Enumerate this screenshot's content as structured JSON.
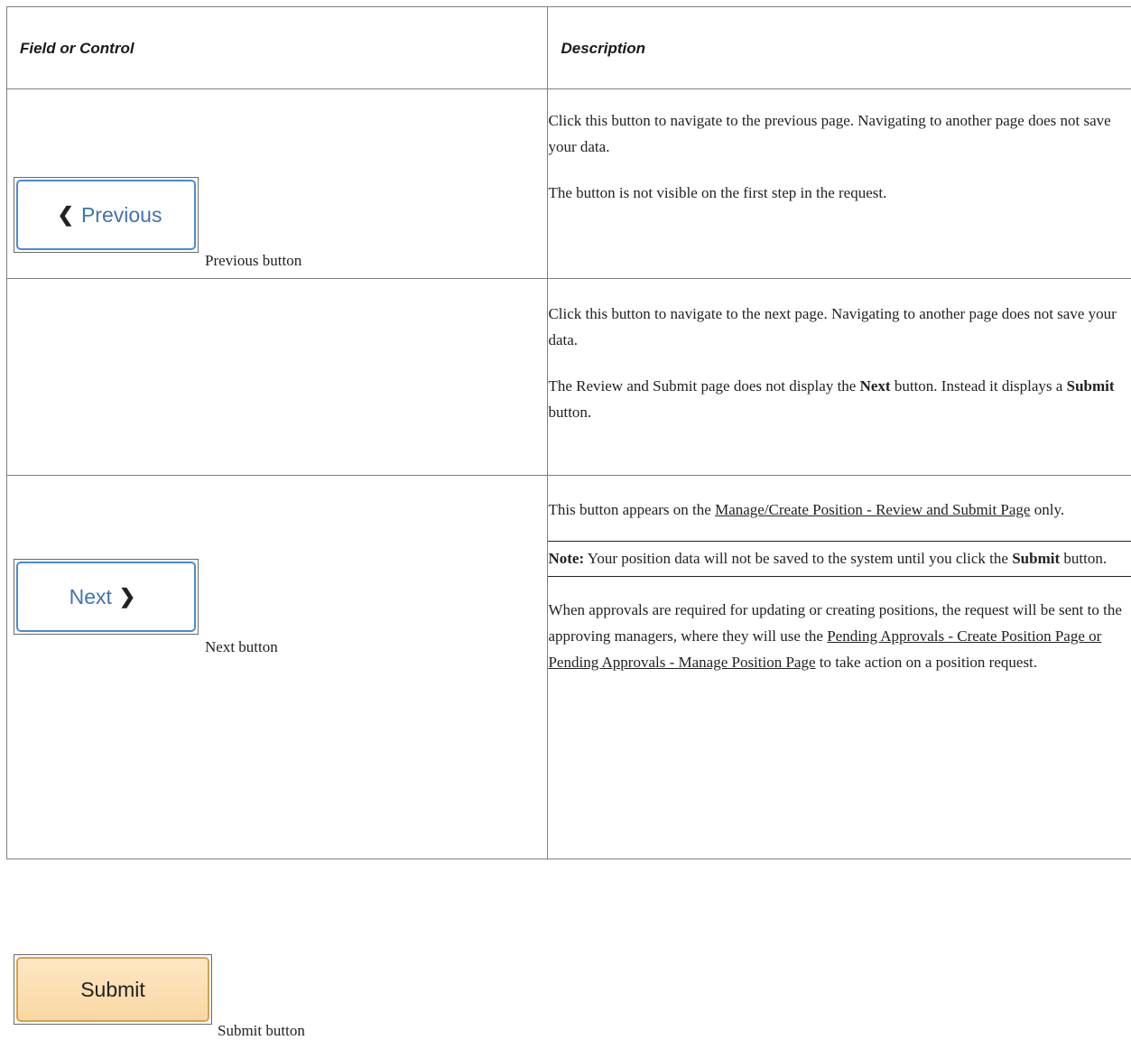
{
  "table": {
    "header": {
      "col1": "Field or Control",
      "col2": "Description"
    },
    "rows": [
      {
        "button_label": "Previous",
        "button_icon": "chevron-left-icon",
        "caption": "Previous button",
        "desc_p1": "Click this button to navigate to the previous page. Navigating to another page does not save your data.",
        "desc_p2": "The button is not visible on the first step in the request."
      },
      {
        "button_label": "Next",
        "button_icon": "chevron-right-icon",
        "caption": "Next button",
        "desc_p1": "Click this button to navigate to the next page. Navigating to another page does not save your data.",
        "desc_p2_a": "The Review and Submit page does not display the ",
        "desc_p2_b1": "Next",
        "desc_p2_c": " button. Instead it displays a ",
        "desc_p2_b2": "Submit",
        "desc_p2_d": "  button."
      },
      {
        "button_label": "Submit",
        "caption": "Submit button",
        "desc_p1_a": "This button appears on the ",
        "desc_p1_link": "Manage/Create Position - Review and Submit Page",
        "desc_p1_b": " only.",
        "note_label": "Note:",
        "note_a": " Your position data will not be saved to the system until you click the ",
        "note_bold": "Submit",
        "note_b": " button.",
        "desc_p3_a": "When approvals are required for updating or creating positions, the request will be sent to the approving managers,  where they will use the ",
        "desc_p3_link": "Pending Approvals - Create Position Page or Pending Approvals - Manage Position Page",
        "desc_p3_b": " to take action on a position request."
      }
    ]
  },
  "colors": {
    "blue_button_border": "#4a8ad1",
    "blue_button_text": "#3f73b3",
    "submit_button_bg": "#fad7a3",
    "submit_button_border": "#d9a24a"
  }
}
